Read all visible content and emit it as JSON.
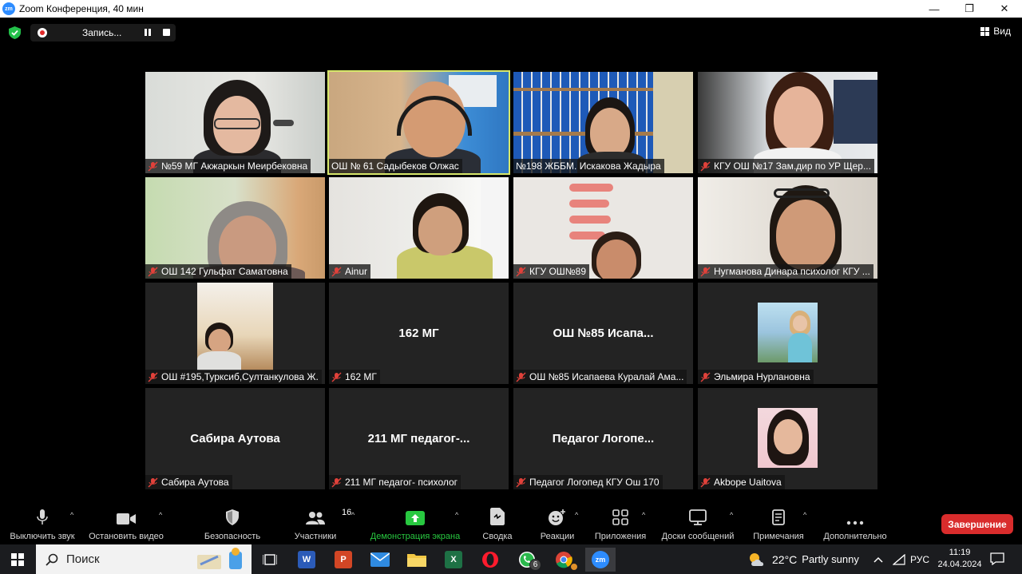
{
  "window": {
    "title": "Zoom Конференция, 40 мин",
    "app_icon_text": "zm",
    "minimize": "—",
    "restore": "❐",
    "close": "✕"
  },
  "topbar": {
    "recording_label": "Запись...",
    "view_label": "Вид"
  },
  "tiles": [
    {
      "name": "№59 МГ Акжаркын Меирбековна",
      "muted": true
    },
    {
      "name": "ОШ № 61 Садыбеков Олжас",
      "muted": false,
      "active": true
    },
    {
      "name": "№198 ЖББМ. Искакова Жадыра",
      "muted": false
    },
    {
      "name": "КГУ ОШ №17 Зам.дир по УР Щер...",
      "muted": true
    },
    {
      "name": "ОШ 142 Гульфат Саматовна",
      "muted": true
    },
    {
      "name": "Ainur",
      "muted": true
    },
    {
      "name": "КГУ ОШ№89",
      "muted": true
    },
    {
      "name": "Нугманова Динара психолог КГУ ...",
      "muted": true
    },
    {
      "name": "ОШ #195,Турксиб,Султанкулова Ж.",
      "muted": true
    },
    {
      "name": "162 МГ",
      "muted": true,
      "center": "162 МГ"
    },
    {
      "name": "ОШ №85 Исапаева Куралай Ама...",
      "muted": true,
      "center": "ОШ №85 Исапа..."
    },
    {
      "name": "Эльмира Нурлановна",
      "muted": true
    },
    {
      "name": "Сабира Аутова",
      "muted": true,
      "center": "Сабира Аутова"
    },
    {
      "name": "211 МГ педагог- психолог",
      "muted": true,
      "center": "211 МГ педагог-..."
    },
    {
      "name": "Педагог Логопед КГУ Ош 170",
      "muted": true,
      "center": "Педагог Логопе..."
    },
    {
      "name": "Akbope Uaitova",
      "muted": true
    }
  ],
  "toolbar": {
    "mute": "Выключить звук",
    "video": "Остановить видео",
    "security": "Безопасность",
    "participants": "Участники",
    "participants_count": "16",
    "share": "Демонстрация экрана",
    "summary": "Сводка",
    "reactions": "Реакции",
    "apps": "Приложения",
    "whiteboards": "Доски сообщений",
    "notes": "Примечания",
    "more": "Дополнительно",
    "end": "Завершение"
  },
  "taskbar": {
    "search_placeholder": "Поиск",
    "whatsapp_badge": "6",
    "weather_temp": "22°C",
    "weather_desc": "Partly sunny",
    "language": "РУС",
    "time": "11:19",
    "date": "24.04.2024",
    "zoom_glyph": "zm"
  },
  "colors": {
    "active_speaker": "#d6e76a",
    "share_green": "#28c840",
    "end_red": "#d92c2c",
    "muted_red": "#e0413a"
  }
}
